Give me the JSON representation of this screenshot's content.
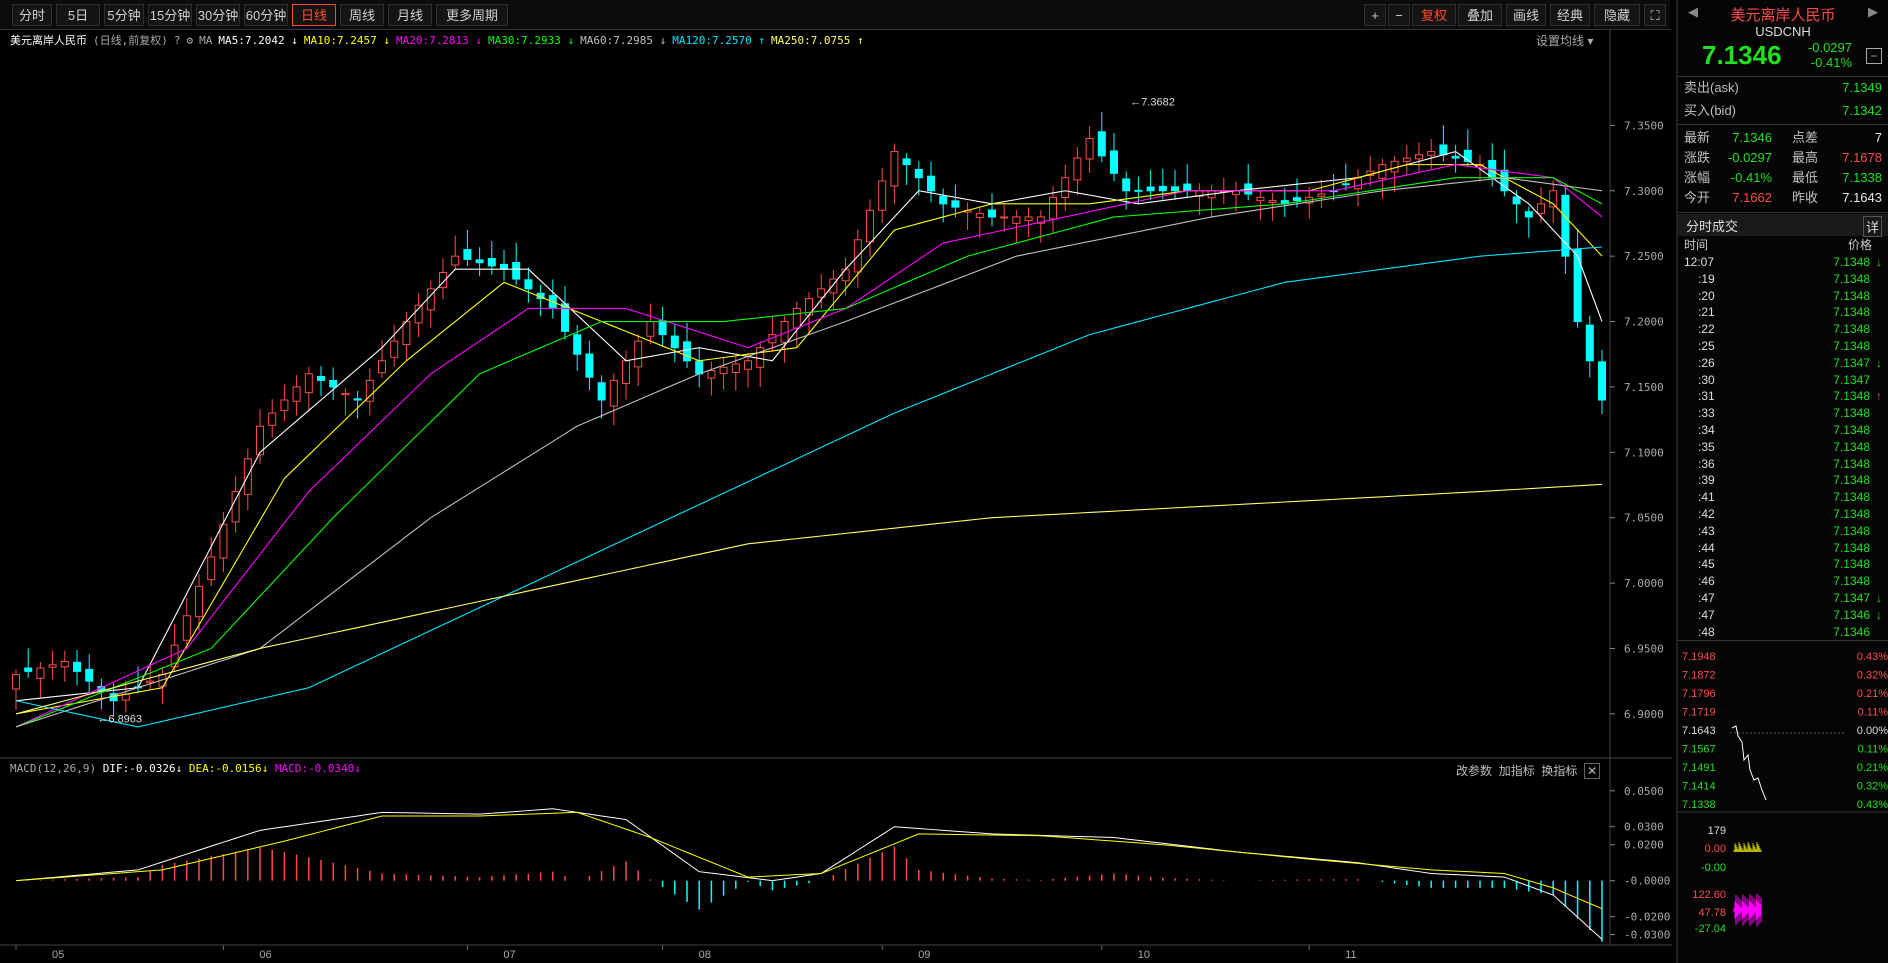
{
  "toolbar": {
    "periods": [
      "分时",
      "5日",
      "5分钟",
      "15分钟",
      "30分钟",
      "60分钟",
      "日线",
      "周线",
      "月线",
      "更多周期"
    ],
    "active": "日线",
    "right": [
      "复权",
      "叠加",
      "画线",
      "经典",
      "隐藏"
    ]
  },
  "info_bar": {
    "name": "美元离岸人民币",
    "sub": "(日线,前复权)",
    "ma_label": "MA",
    "ma": [
      {
        "text": "MA5:7.2042",
        "arrow": "↓",
        "color": "#ffffff"
      },
      {
        "text": "MA10:7.2457",
        "arrow": "↓",
        "color": "#ffff00"
      },
      {
        "text": "MA20:7.2813",
        "arrow": "↓",
        "color": "#ff00ff"
      },
      {
        "text": "MA30:7.2933",
        "arrow": "↓",
        "color": "#00ff00"
      },
      {
        "text": "MA60:7.2985",
        "arrow": "↓",
        "color": "#c0c0c0"
      },
      {
        "text": "MA120:7.2570",
        "arrow": "↑",
        "color": "#00e5ff"
      },
      {
        "text": "MA250:7.0755",
        "arrow": "↑",
        "color": "#ffff66"
      }
    ],
    "settings": "设置均线"
  },
  "macd_info": {
    "name": "MACD(12,26,9)",
    "dif": "DIF:-0.0326",
    "dif_arrow": "↓",
    "dea": "DEA:-0.0156",
    "dea_arrow": "↓",
    "macd": "MACD:-0.0340",
    "macd_arrow": "↓",
    "buttons": [
      "改参数",
      "加指标",
      "换指标"
    ]
  },
  "colors": {
    "up": "#ff4b4b",
    "down": "#00ffff",
    "ma5": "#ffffff",
    "ma10": "#ffff00",
    "ma20": "#ff00ff",
    "ma30": "#00ff00",
    "ma60": "#c0c0c0",
    "ma120": "#00e5ff",
    "ma250": "#ffff66",
    "dif": "#ffffff",
    "dea": "#ffff00"
  },
  "chart_data": [
    {
      "type": "candlestick",
      "title": "美元离岸人民币",
      "y_ticks": [
        7.35,
        7.3,
        7.25,
        7.2,
        7.15,
        7.1,
        7.05,
        7.0,
        6.95,
        6.9
      ],
      "ylim": [
        6.88,
        7.4
      ],
      "x_ticks": [
        "05",
        "06",
        "07",
        "08",
        "09",
        "10",
        "11"
      ],
      "annotations": [
        "7.3682",
        "6.8963"
      ],
      "ohlc_count": 131,
      "close_anchors": [
        [
          0,
          6.93
        ],
        [
          4,
          6.94
        ],
        [
          8,
          6.91
        ],
        [
          12,
          6.93
        ],
        [
          16,
          7.02
        ],
        [
          20,
          7.12
        ],
        [
          24,
          7.16
        ],
        [
          28,
          7.14
        ],
        [
          32,
          7.2
        ],
        [
          36,
          7.25
        ],
        [
          40,
          7.24
        ],
        [
          44,
          7.21
        ],
        [
          48,
          7.14
        ],
        [
          52,
          7.2
        ],
        [
          56,
          7.16
        ],
        [
          60,
          7.17
        ],
        [
          64,
          7.21
        ],
        [
          68,
          7.24
        ],
        [
          72,
          7.33
        ],
        [
          76,
          7.29
        ],
        [
          80,
          7.28
        ],
        [
          84,
          7.28
        ],
        [
          88,
          7.34
        ],
        [
          91,
          7.3
        ],
        [
          96,
          7.3
        ],
        [
          100,
          7.3
        ],
        [
          104,
          7.29
        ],
        [
          108,
          7.3
        ],
        [
          112,
          7.32
        ],
        [
          116,
          7.33
        ],
        [
          120,
          7.32
        ],
        [
          124,
          7.28
        ],
        [
          126,
          7.3
        ],
        [
          128,
          7.2
        ],
        [
          130,
          7.14
        ]
      ],
      "ma_anchors": {
        "MA5": [
          [
            0,
            6.91
          ],
          [
            10,
            6.92
          ],
          [
            20,
            7.1
          ],
          [
            30,
            7.18
          ],
          [
            36,
            7.24
          ],
          [
            42,
            7.24
          ],
          [
            50,
            7.17
          ],
          [
            56,
            7.18
          ],
          [
            62,
            7.17
          ],
          [
            68,
            7.24
          ],
          [
            74,
            7.3
          ],
          [
            80,
            7.29
          ],
          [
            86,
            7.3
          ],
          [
            92,
            7.29
          ],
          [
            100,
            7.3
          ],
          [
            110,
            7.31
          ],
          [
            118,
            7.33
          ],
          [
            124,
            7.29
          ],
          [
            128,
            7.25
          ],
          [
            130,
            7.2
          ]
        ],
        "MA10": [
          [
            0,
            6.9
          ],
          [
            12,
            6.92
          ],
          [
            22,
            7.08
          ],
          [
            32,
            7.17
          ],
          [
            40,
            7.23
          ],
          [
            48,
            7.2
          ],
          [
            56,
            7.17
          ],
          [
            64,
            7.18
          ],
          [
            72,
            7.27
          ],
          [
            80,
            7.29
          ],
          [
            88,
            7.29
          ],
          [
            96,
            7.3
          ],
          [
            106,
            7.3
          ],
          [
            114,
            7.32
          ],
          [
            120,
            7.32
          ],
          [
            126,
            7.29
          ],
          [
            130,
            7.25
          ]
        ],
        "MA20": [
          [
            0,
            6.89
          ],
          [
            14,
            6.95
          ],
          [
            24,
            7.07
          ],
          [
            34,
            7.16
          ],
          [
            42,
            7.21
          ],
          [
            50,
            7.21
          ],
          [
            60,
            7.18
          ],
          [
            68,
            7.21
          ],
          [
            76,
            7.26
          ],
          [
            86,
            7.28
          ],
          [
            96,
            7.3
          ],
          [
            108,
            7.3
          ],
          [
            118,
            7.32
          ],
          [
            126,
            7.31
          ],
          [
            130,
            7.28
          ]
        ],
        "MA30": [
          [
            0,
            6.89
          ],
          [
            16,
            6.95
          ],
          [
            26,
            7.05
          ],
          [
            38,
            7.16
          ],
          [
            48,
            7.2
          ],
          [
            58,
            7.2
          ],
          [
            68,
            7.21
          ],
          [
            78,
            7.25
          ],
          [
            90,
            7.28
          ],
          [
            104,
            7.29
          ],
          [
            118,
            7.31
          ],
          [
            126,
            7.31
          ],
          [
            130,
            7.29
          ]
        ],
        "MA60": [
          [
            0,
            6.89
          ],
          [
            20,
            6.95
          ],
          [
            34,
            7.05
          ],
          [
            46,
            7.12
          ],
          [
            56,
            7.16
          ],
          [
            68,
            7.2
          ],
          [
            82,
            7.25
          ],
          [
            98,
            7.28
          ],
          [
            112,
            7.3
          ],
          [
            122,
            7.31
          ],
          [
            130,
            7.3
          ]
        ],
        "MA120": [
          [
            0,
            6.91
          ],
          [
            10,
            6.89
          ],
          [
            24,
            6.92
          ],
          [
            40,
            6.99
          ],
          [
            56,
            7.06
          ],
          [
            72,
            7.13
          ],
          [
            88,
            7.19
          ],
          [
            104,
            7.23
          ],
          [
            120,
            7.25
          ],
          [
            130,
            7.257
          ]
        ],
        "MA250": [
          [
            0,
            6.9
          ],
          [
            20,
            6.95
          ],
          [
            40,
            6.99
          ],
          [
            60,
            7.03
          ],
          [
            80,
            7.05
          ],
          [
            100,
            7.06
          ],
          [
            120,
            7.07
          ],
          [
            130,
            7.0755
          ]
        ]
      }
    },
    {
      "type": "macd",
      "title": "MACD(12,26,9)",
      "y_ticks": [
        0.05,
        0.03,
        0.02,
        0.0,
        -0.02,
        -0.03
      ],
      "y_tick_labels": [
        "0.0500",
        "0.0300",
        "0.0200",
        "-0.0000",
        "-0.0200",
        "-0.0300"
      ],
      "ylim": [
        -0.033,
        0.056
      ],
      "dif_anchors": [
        [
          0,
          0.0
        ],
        [
          10,
          0.006
        ],
        [
          20,
          0.028
        ],
        [
          30,
          0.038
        ],
        [
          38,
          0.037
        ],
        [
          44,
          0.04
        ],
        [
          50,
          0.034
        ],
        [
          56,
          0.005
        ],
        [
          62,
          0.0
        ],
        [
          66,
          0.004
        ],
        [
          72,
          0.03
        ],
        [
          80,
          0.026
        ],
        [
          90,
          0.024
        ],
        [
          100,
          0.016
        ],
        [
          110,
          0.01
        ],
        [
          116,
          0.004
        ],
        [
          122,
          0.002
        ],
        [
          126,
          -0.008
        ],
        [
          130,
          -0.0326
        ]
      ],
      "dea_anchors": [
        [
          0,
          0.0
        ],
        [
          12,
          0.006
        ],
        [
          22,
          0.022
        ],
        [
          30,
          0.036
        ],
        [
          38,
          0.036
        ],
        [
          46,
          0.038
        ],
        [
          52,
          0.024
        ],
        [
          60,
          0.002
        ],
        [
          66,
          0.004
        ],
        [
          74,
          0.026
        ],
        [
          84,
          0.025
        ],
        [
          94,
          0.02
        ],
        [
          106,
          0.012
        ],
        [
          116,
          0.006
        ],
        [
          122,
          0.004
        ],
        [
          126,
          -0.004
        ],
        [
          130,
          -0.0156
        ]
      ]
    }
  ],
  "right_panel": {
    "name": "美元离岸人民币",
    "code": "USDCNH",
    "price": "7.1346",
    "change": "-0.0297",
    "change_pct": "-0.41%",
    "ask_label": "卖出(ask)",
    "ask": "7.1349",
    "bid_label": "买入(bid)",
    "bid": "7.1342",
    "stats": [
      {
        "l1": "最新",
        "v1": "7.1346",
        "c1": "grn",
        "l2": "点差",
        "v2": "7",
        "c2": "wht"
      },
      {
        "l1": "涨跌",
        "v1": "-0.0297",
        "c1": "grn",
        "l2": "最高",
        "v2": "7.1678",
        "c2": "red"
      },
      {
        "l1": "涨幅",
        "v1": "-0.41%",
        "c1": "grn",
        "l2": "最低",
        "v2": "7.1338",
        "c2": "grn"
      },
      {
        "l1": "今开",
        "v1": "7.1662",
        "c1": "red",
        "l2": "昨收",
        "v2": "7.1643",
        "c2": "wht"
      }
    ],
    "ticks_title": "分时成交",
    "detail": "详",
    "ticks_head": [
      "时间",
      "价格"
    ],
    "ticks": [
      {
        "t": "12:07",
        "p": "7.1348",
        "a": "↓"
      },
      {
        "t": ":19",
        "p": "7.1348",
        "a": ""
      },
      {
        "t": ":20",
        "p": "7.1348",
        "a": ""
      },
      {
        "t": ":21",
        "p": "7.1348",
        "a": ""
      },
      {
        "t": ":22",
        "p": "7.1348",
        "a": ""
      },
      {
        "t": ":25",
        "p": "7.1348",
        "a": ""
      },
      {
        "t": ":26",
        "p": "7.1347",
        "a": "↓"
      },
      {
        "t": ":30",
        "p": "7.1347",
        "a": ""
      },
      {
        "t": ":31",
        "p": "7.1348",
        "a": "↑"
      },
      {
        "t": ":33",
        "p": "7.1348",
        "a": ""
      },
      {
        "t": ":34",
        "p": "7.1348",
        "a": ""
      },
      {
        "t": ":35",
        "p": "7.1348",
        "a": ""
      },
      {
        "t": ":36",
        "p": "7.1348",
        "a": ""
      },
      {
        "t": ":39",
        "p": "7.1348",
        "a": ""
      },
      {
        "t": ":41",
        "p": "7.1348",
        "a": ""
      },
      {
        "t": ":42",
        "p": "7.1348",
        "a": ""
      },
      {
        "t": ":43",
        "p": "7.1348",
        "a": ""
      },
      {
        "t": ":44",
        "p": "7.1348",
        "a": ""
      },
      {
        "t": ":45",
        "p": "7.1348",
        "a": ""
      },
      {
        "t": ":46",
        "p": "7.1348",
        "a": ""
      },
      {
        "t": ":47",
        "p": "7.1347",
        "a": "↓"
      },
      {
        "t": ":47",
        "p": "7.1346",
        "a": "↓"
      },
      {
        "t": ":48",
        "p": "7.1346",
        "a": ""
      }
    ],
    "mini_left": [
      "7.1948",
      "7.1872",
      "7.1796",
      "7.1719",
      "7.1643",
      "7.1567",
      "7.1491",
      "7.1414",
      "7.1338"
    ],
    "mini_right": [
      "0.43%",
      "0.32%",
      "0.21%",
      "0.11%",
      "0.00%",
      "0.11%",
      "0.21%",
      "0.32%",
      "0.43%"
    ],
    "sub_left": [
      "179",
      "0.00",
      "-0.00",
      "122.60",
      "47.78",
      "-27.04"
    ]
  }
}
